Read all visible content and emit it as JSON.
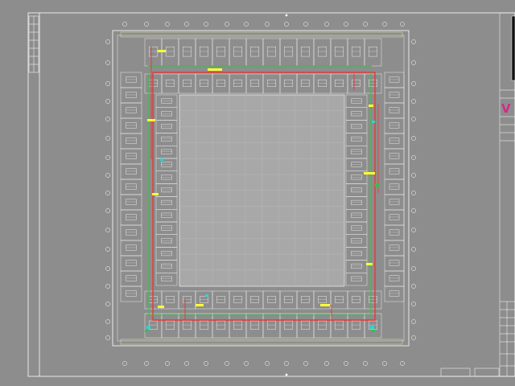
{
  "drawing": {
    "background": "#8d8d8d",
    "line_color": "#ffffff",
    "courtyard_color": "#a8a8a8",
    "pipe_colors": {
      "red": "#e63a3a",
      "green": "#29c93c",
      "yellow": "#ffff33",
      "cyan": "#2fd4d4"
    },
    "title_block_mark": "V",
    "title_block_mark_color": "#d22a8a"
  },
  "icons": {
    "compass": "north-arrow-icon"
  }
}
